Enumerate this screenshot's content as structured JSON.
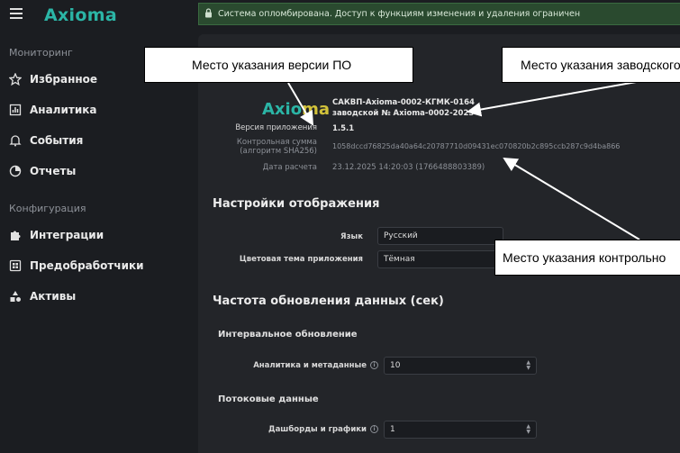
{
  "sidebar": {
    "logo_text_1": "Axi",
    "logo_text_2": "oma",
    "sections": [
      {
        "title": "Мониторинг"
      },
      {
        "title": "Конфигурация"
      }
    ],
    "items": [
      {
        "label": "Избранное",
        "icon": "star-icon"
      },
      {
        "label": "Аналитика",
        "icon": "chart-icon"
      },
      {
        "label": "События",
        "icon": "bell-icon"
      },
      {
        "label": "Отчеты",
        "icon": "pie-icon"
      },
      {
        "label": "Интеграции",
        "icon": "puzzle-icon"
      },
      {
        "label": "Предобработчики",
        "icon": "processor-icon"
      },
      {
        "label": "Активы",
        "icon": "shapes-icon"
      }
    ]
  },
  "banner": {
    "text": "Система опломбирована. Доступ к функциям изменения и удаления ограничен"
  },
  "about": {
    "logo_1": "Axio",
    "logo_2": "ma",
    "product_line1": "САКВП-Axioma-0002-КГМК-0164",
    "product_line2": "заводской № Axioma-0002-2025",
    "version_label": "Версия приложения",
    "version_value": "1.5.1",
    "checksum_label_1": "Контрольная сумма",
    "checksum_label_2": "(алгоритм SHA256)",
    "checksum_value": "1058dccd76825da40a64c20787710d09431ec070820b2c895ccb287c9d4ba866",
    "calc_date_label": "Дата расчета",
    "calc_date_value": "23.12.2025 14:20:03 (1766488803389)"
  },
  "display_settings": {
    "title": "Настройки отображения",
    "language_label": "Язык",
    "language_value": "Русский",
    "theme_label": "Цветовая тема приложения",
    "theme_value": "Тёмная"
  },
  "refresh": {
    "title": "Частота обновления данных (сек)",
    "interval_title": "Интервальное обновление",
    "analytics_label": "Аналитика и метаданные",
    "analytics_value": "10",
    "stream_title": "Потоковые данные",
    "dashboards_label": "Дашборды и графики",
    "dashboards_value": "1"
  },
  "callouts": {
    "version": "Место указания версии ПО",
    "serial": "Место указания заводского",
    "checksum": "Место указания контрольно"
  }
}
